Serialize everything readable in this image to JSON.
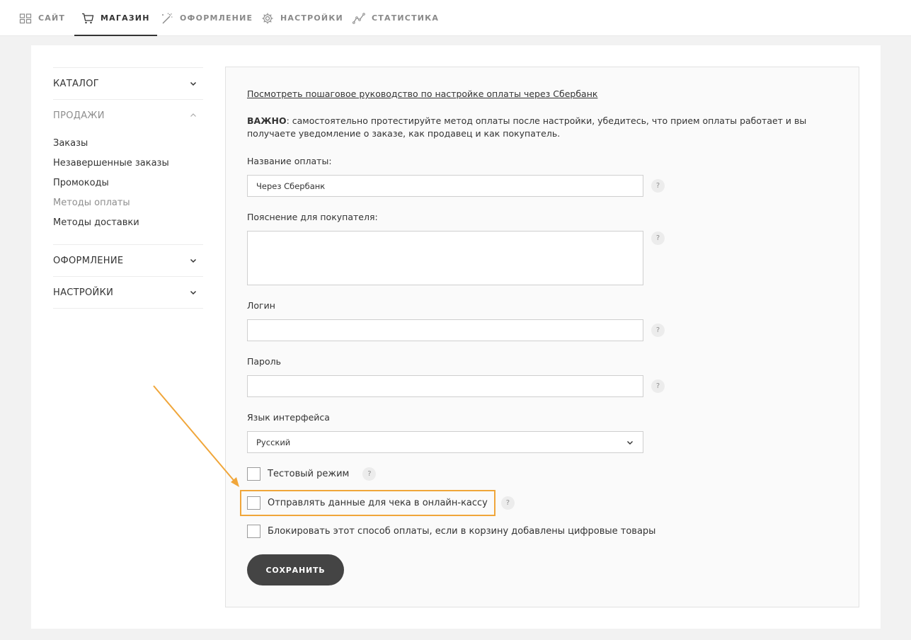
{
  "topnav": {
    "items": [
      {
        "label": "САЙТ",
        "icon": "grid-icon",
        "active": false
      },
      {
        "label": "МАГАЗИН",
        "icon": "cart-icon",
        "active": true
      },
      {
        "label": "ОФОРМЛЕНИЕ",
        "icon": "magic-wand-icon",
        "active": false
      },
      {
        "label": "НАСТРОЙКИ",
        "icon": "gear-icon",
        "active": false
      },
      {
        "label": "СТАТИСТИКА",
        "icon": "chart-line-icon",
        "active": false
      }
    ]
  },
  "sidebar": {
    "catalog": "КАТАЛОГ",
    "sales": "ПРОДАЖИ",
    "sales_items": [
      "Заказы",
      "Незавершенные заказы",
      "Промокоды",
      "Методы оплаты",
      "Методы доставки"
    ],
    "current_item": "Методы оплаты",
    "design": "ОФОРМЛЕНИЕ",
    "settings": "НАСТРОЙКИ"
  },
  "form": {
    "guide_link": "Посмотреть пошаговое руководство по настройке оплаты через Сбербанк",
    "important_label": "ВАЖНО",
    "important_text": ": самостоятельно протестируйте метод оплаты после настройки, убедитесь, что прием оплаты работает и вы получаете уведомление о заказе, как продавец и как покупатель.",
    "payment_name_label": "Название оплаты:",
    "payment_name_value": "Через Сбербанк",
    "description_label": "Пояснение для покупателя:",
    "description_value": "",
    "login_label": "Логин",
    "login_value": "",
    "password_label": "Пароль",
    "password_value": "",
    "language_label": "Язык интерфейса",
    "language_value": "Русский",
    "checkboxes": [
      {
        "label": "Тестовый режим",
        "checked": false,
        "help": true
      },
      {
        "label": "Отправлять данные для чека в онлайн-кассу",
        "checked": false,
        "help": true
      },
      {
        "label": "Блокировать этот способ оплаты, если в корзину добавлены цифровые товары",
        "checked": false,
        "help": false
      }
    ],
    "help_glyph": "?",
    "save_label": "СОХРАНИТЬ"
  },
  "colors": {
    "highlight": "#f0a63a",
    "button": "#444444",
    "page_bg": "#f2f2f2"
  }
}
